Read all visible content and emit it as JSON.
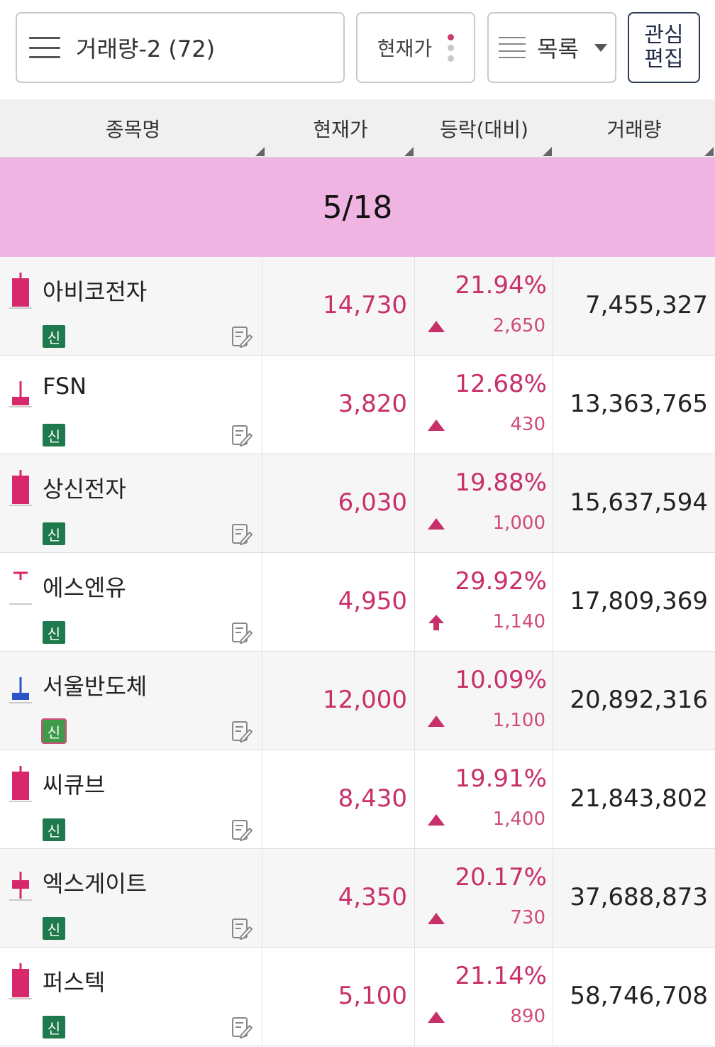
{
  "toolbar": {
    "group_label": "거래량-2 (72)",
    "price_label": "현재가",
    "view_label": "목록",
    "edit_label": "관심\n편집"
  },
  "columns": {
    "name": "종목명",
    "price": "현재가",
    "change": "등락(대비)",
    "volume": "거래량"
  },
  "date_band": "5/18",
  "colors": {
    "up": "#c8306a",
    "date_band": "#efb4e2",
    "new_badge": "#1e7a4c",
    "candle_up": "#d6286a",
    "candle_down": "#2a55c8"
  },
  "rows": [
    {
      "name": "아비코전자",
      "badge": "신",
      "price": "14,730",
      "pct": "21.94%",
      "diff": "2,650",
      "volume": "7,455,327",
      "marker": "up-triangle",
      "candle": "bull-long"
    },
    {
      "name": "FSN",
      "badge": "신",
      "price": "3,820",
      "pct": "12.68%",
      "diff": "430",
      "volume": "13,363,765",
      "marker": "up-triangle",
      "candle": "bull-small"
    },
    {
      "name": "상신전자",
      "badge": "신",
      "price": "6,030",
      "pct": "19.88%",
      "diff": "1,000",
      "volume": "15,637,594",
      "marker": "up-triangle",
      "candle": "bull-long"
    },
    {
      "name": "에스엔유",
      "badge": "신",
      "price": "4,950",
      "pct": "29.92%",
      "diff": "1,140",
      "volume": "17,809,369",
      "marker": "limit-up-arrow",
      "candle": "limit-up"
    },
    {
      "name": "서울반도체",
      "badge": "신",
      "price": "12,000",
      "pct": "10.09%",
      "diff": "1,100",
      "volume": "20,892,316",
      "marker": "up-triangle",
      "candle": "bear-small"
    },
    {
      "name": "씨큐브",
      "badge": "신",
      "price": "8,430",
      "pct": "19.91%",
      "diff": "1,400",
      "volume": "21,843,802",
      "marker": "up-triangle",
      "candle": "bull-long"
    },
    {
      "name": "엑스게이트",
      "badge": "신",
      "price": "4,350",
      "pct": "20.17%",
      "diff": "730",
      "volume": "37,688,873",
      "marker": "up-triangle",
      "candle": "bull-cross"
    },
    {
      "name": "퍼스텍",
      "badge": "신",
      "price": "5,100",
      "pct": "21.14%",
      "diff": "890",
      "volume": "58,746,708",
      "marker": "up-triangle",
      "candle": "bull-long"
    }
  ]
}
